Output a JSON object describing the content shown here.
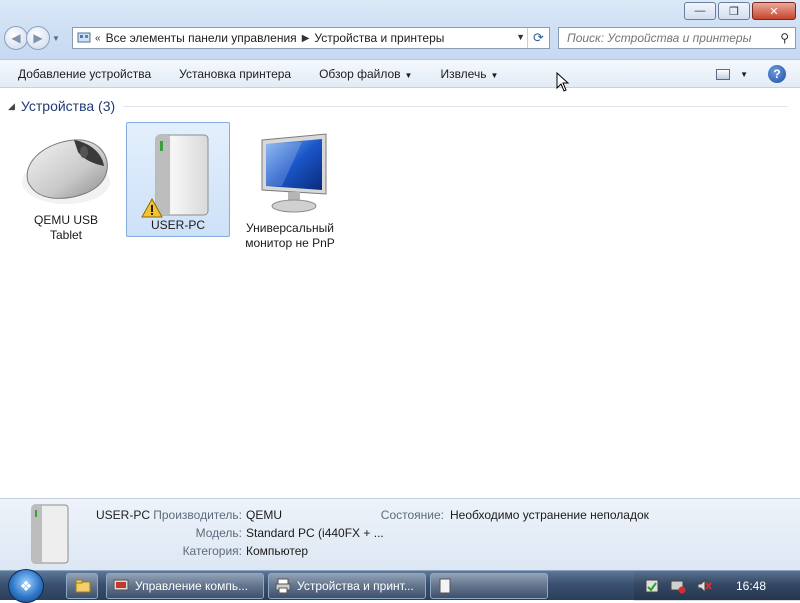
{
  "window": {
    "controls": {
      "minimize": "—",
      "maximize": "❐",
      "close": "✕"
    }
  },
  "address": {
    "crumbs": [
      "Все элементы панели управления",
      "Устройства и принтеры"
    ]
  },
  "search": {
    "placeholder": "Поиск: Устройства и принтеры"
  },
  "toolbar": {
    "add_device": "Добавление устройства",
    "install_printer": "Установка принтера",
    "browse_files": "Обзор файлов",
    "eject": "Извлечь"
  },
  "devices": {
    "group_title": "Устройства (3)",
    "items": [
      {
        "label_line1": "QEMU USB",
        "label_line2": "Tablet",
        "icon": "mouse-icon"
      },
      {
        "label_line1": "USER-PC",
        "label_line2": "",
        "icon": "computer-icon",
        "warning": true,
        "selected": true
      },
      {
        "label_line1": "Универсальный",
        "label_line2": "монитор не PnP",
        "icon": "monitor-icon"
      }
    ]
  },
  "details": {
    "name": "USER-PC",
    "manufacturer_label": "Производитель:",
    "manufacturer": "QEMU",
    "model_label": "Модель:",
    "model": "Standard PC (i440FX + ...",
    "category_label": "Категория:",
    "category": "Компьютер",
    "status_label": "Состояние:",
    "status": "Необходимо устранение неполадок"
  },
  "taskbar": {
    "buttons": [
      "Управление компь...",
      "Устройства и принт..."
    ],
    "clock": "16:48"
  },
  "colors": {
    "accent": "#3a5070",
    "selection": "#cde1f7",
    "group_title": "#1f3b77"
  }
}
